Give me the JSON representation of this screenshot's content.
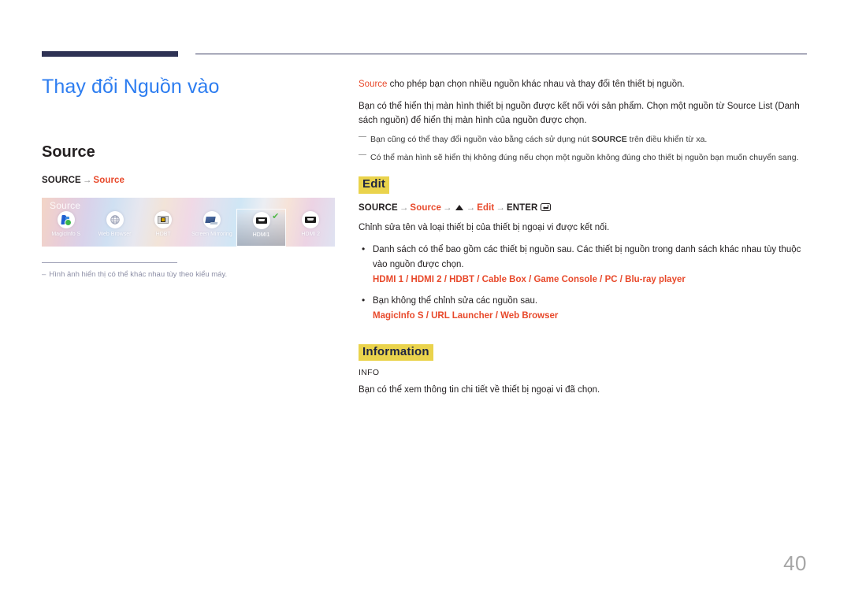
{
  "header": {
    "rule": "decorative-double-rule"
  },
  "page": {
    "title": "Thay đổi Nguồn vào",
    "number": "40"
  },
  "left": {
    "section_heading": "Source",
    "nav_path": {
      "root": "SOURCE",
      "arrow": "→",
      "target": "Source"
    },
    "screenshot": {
      "osd_label": "Source",
      "tiles": [
        {
          "label": "MagicInfo S",
          "icon": "magicinfo-icon",
          "selected": false
        },
        {
          "label": "Web Browser",
          "icon": "globe-icon",
          "selected": false
        },
        {
          "label": "HDBT",
          "icon": "hdbt-icon",
          "selected": false
        },
        {
          "label": "Screen Mirroring",
          "icon": "screen-mirroring-icon",
          "selected": false
        },
        {
          "label": "HDMI1",
          "icon": "hdmi-icon",
          "selected": true
        },
        {
          "label": "HDMI 2",
          "icon": "hdmi-icon",
          "selected": false
        }
      ],
      "selected_check": "✔"
    },
    "note": {
      "dash": "–",
      "text": "Hình ảnh hiển thị có thể khác nhau tùy theo kiểu máy."
    }
  },
  "right": {
    "intro": {
      "accent": "Source",
      "rest": " cho phép bạn chọn nhiều nguồn khác nhau và thay đổi tên thiết bị nguồn."
    },
    "paragraph2": "Bạn có thể hiển thị màn hình thiết bị nguồn được kết nối với sản phẩm. Chọn một nguồn từ Source List (Danh sách nguồn) để hiển thị màn hình của nguồn được chọn.",
    "dash_notes": [
      {
        "pre": "Bạn cũng có thể thay đổi nguồn vào bằng cách sử dụng nút ",
        "bold": "SOURCE",
        "post": " trên điều khiển từ xa."
      },
      {
        "pre": "Có thể màn hình sẽ hiển thị không đúng nếu chọn một nguồn không đúng cho thiết bị nguồn bạn muốn chuyển sang.",
        "bold": "",
        "post": ""
      }
    ],
    "edit": {
      "badge": "Edit",
      "nav_path": {
        "root": "SOURCE",
        "step1": "Source",
        "step2_icon": "triangle-up-icon",
        "step3": "Edit",
        "enter": "ENTER",
        "enter_icon": "enter-key-icon",
        "arrow": "→"
      },
      "description": "Chỉnh sửa tên và loại thiết bị của thiết bị ngoại vi được kết nối.",
      "bullets": [
        {
          "text": "Danh sách có thể bao gồm các thiết bị nguồn sau. Các thiết bị nguồn trong danh sách khác nhau tùy thuộc vào nguồn được chọn.",
          "accent_line": "HDMI 1 / HDMI 2 / HDBT / Cable Box / Game Console / PC / Blu-ray player"
        },
        {
          "text": "Bạn không thể chỉnh sửa các nguồn sau.",
          "accent_line": "MagicInfo S / URL Launcher / Web Browser"
        }
      ]
    },
    "information": {
      "badge": "Information",
      "label": "INFO",
      "description": "Bạn có thể xem thông tin chi tiết về thiết bị ngoại vi đã chọn."
    }
  },
  "colors": {
    "title_blue": "#2d7df0",
    "accent_orange": "#e8492b",
    "badge_yellow": "#ead34c",
    "rule_navy": "#2e3254",
    "page_number_gray": "#a6a6a6"
  }
}
